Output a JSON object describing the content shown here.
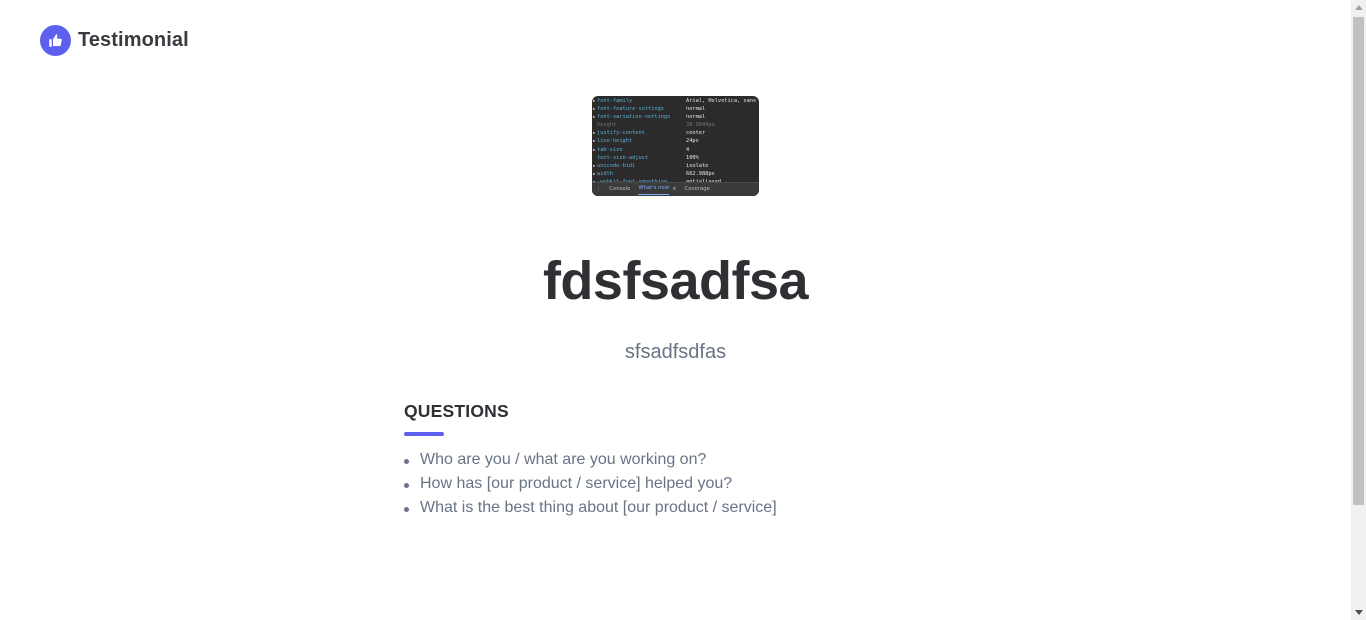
{
  "brand": {
    "name": "Testimonial",
    "icon": "thumbs-up-icon",
    "color": "#5d5fef"
  },
  "preview": {
    "rows": [
      {
        "prop": "font-family",
        "val": "Arial, Helvetica, sans"
      },
      {
        "prop": "font-feature-settings",
        "val": "normal"
      },
      {
        "prop": "font-variation-settings",
        "val": "normal"
      },
      {
        "prop": "height",
        "val": "39.9844px"
      },
      {
        "prop": "justify-content",
        "val": "center"
      },
      {
        "prop": "line-height",
        "val": "24px"
      },
      {
        "prop": "tab-size",
        "val": "4"
      },
      {
        "prop": "text-size-adjust",
        "val": "100%"
      },
      {
        "prop": "unicode-bidi",
        "val": "isolate"
      },
      {
        "prop": "width",
        "val": "662.988px"
      },
      {
        "prop": "-webkit-font-smoothing",
        "val": "antialiased"
      }
    ],
    "tabs": {
      "console": "Console",
      "whats_new": "What's new",
      "close": "×",
      "coverage": "Coverage"
    }
  },
  "title": "fdsfsadfsa",
  "subtitle": "sfsadfsdfas",
  "questions": {
    "heading": "QUESTIONS",
    "items": [
      "Who are you / what are you working on?",
      "How has [our product / service] helped you?",
      "What is the best thing about [our product / service]"
    ]
  }
}
